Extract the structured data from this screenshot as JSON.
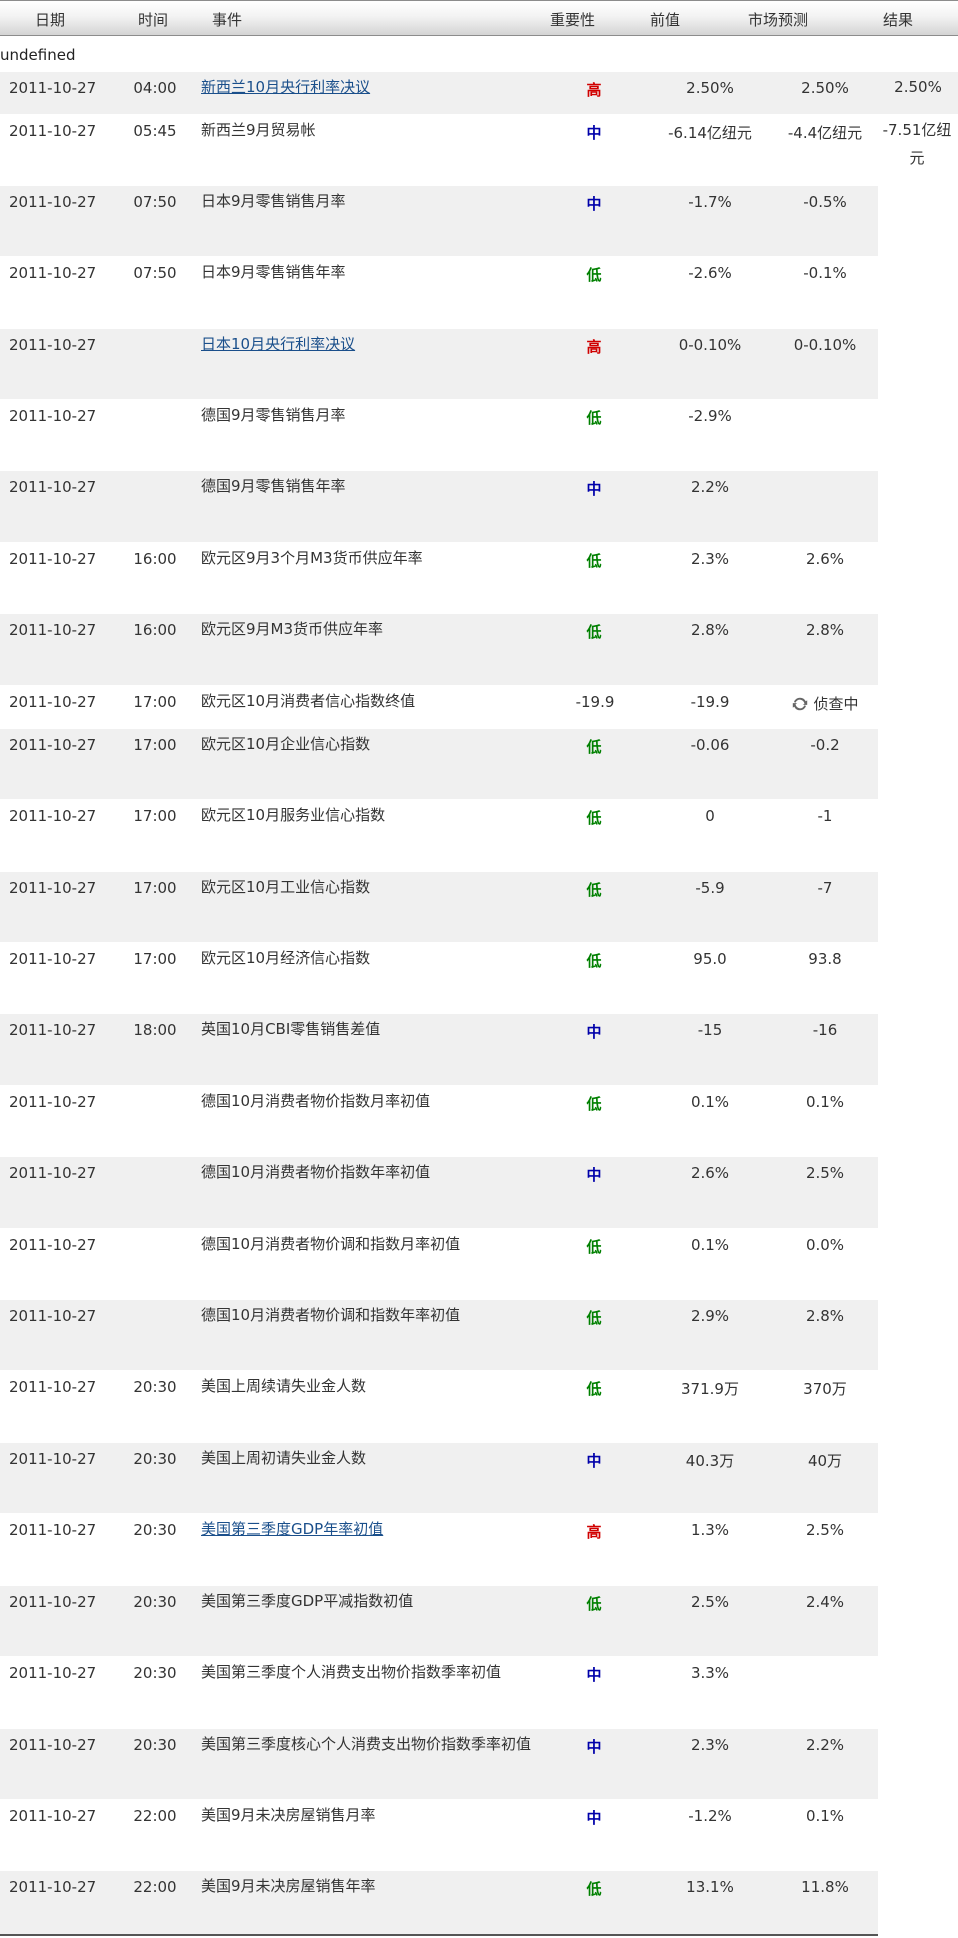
{
  "header": {
    "date": "日期",
    "time": "时间",
    "event": "事件",
    "importance": "重要性",
    "previous": "前值",
    "forecast": "市场预测",
    "result": "结果"
  },
  "undefined_label": "undefined",
  "colors": {
    "high": "#d00000",
    "mid": "#0000aa",
    "low": "#008000",
    "link": "#1a4f8b",
    "row_alt": "#f0f0f0"
  },
  "rows": [
    {
      "date": "2011-10-27",
      "time": "04:00",
      "event": "新西兰10月央行利率决议",
      "link": true,
      "importance": "高",
      "level": "high",
      "previous": "2.50%",
      "forecast": "2.50%",
      "result": "2.50%"
    },
    {
      "date": "2011-10-27",
      "time": "05:45",
      "event": "新西兰9月贸易帐",
      "link": false,
      "importance": "中",
      "level": "mid",
      "previous": "-6.14亿纽元",
      "forecast": "-4.4亿纽元",
      "result": "-7.51亿纽元"
    },
    {
      "date": "2011-10-27",
      "time": "07:50",
      "event": "日本9月零售销售月率",
      "link": false,
      "importance": "中",
      "level": "mid",
      "previous": "-1.7%",
      "forecast": "-0.5%",
      "result": ""
    },
    {
      "date": "2011-10-27",
      "time": "07:50",
      "event": "日本9月零售销售年率",
      "link": false,
      "importance": "低",
      "level": "low",
      "previous": "-2.6%",
      "forecast": "-0.1%",
      "result": ""
    },
    {
      "date": "2011-10-27",
      "time": "",
      "event": "日本10月央行利率决议",
      "link": true,
      "importance": "高",
      "level": "high",
      "previous": "0-0.10%",
      "forecast": "0-0.10%",
      "result": ""
    },
    {
      "date": "2011-10-27",
      "time": "",
      "event": "德国9月零售销售月率",
      "link": false,
      "importance": "低",
      "level": "low",
      "previous": "-2.9%",
      "forecast": "",
      "result": ""
    },
    {
      "date": "2011-10-27",
      "time": "",
      "event": "德国9月零售销售年率",
      "link": false,
      "importance": "中",
      "level": "mid",
      "previous": "2.2%",
      "forecast": "",
      "result": ""
    },
    {
      "date": "2011-10-27",
      "time": "16:00",
      "event": "欧元区9月3个月M3货币供应年率",
      "link": false,
      "importance": "低",
      "level": "low",
      "previous": "2.3%",
      "forecast": "2.6%",
      "result": ""
    },
    {
      "date": "2011-10-27",
      "time": "16:00",
      "event": "欧元区9月M3货币供应年率",
      "link": false,
      "importance": "低",
      "level": "low",
      "previous": "2.8%",
      "forecast": "2.8%",
      "result": ""
    },
    {
      "date": "2011-10-27",
      "time": "17:00",
      "event": "欧元区10月消费者信心指数终值",
      "link": false,
      "importance": "-19.9",
      "level": "num",
      "previous": "-19.9",
      "forecast": "",
      "result": "",
      "pending": "侦查中"
    },
    {
      "date": "2011-10-27",
      "time": "17:00",
      "event": "欧元区10月企业信心指数",
      "link": false,
      "importance": "低",
      "level": "low",
      "previous": "-0.06",
      "forecast": "-0.2",
      "result": ""
    },
    {
      "date": "2011-10-27",
      "time": "17:00",
      "event": "欧元区10月服务业信心指数",
      "link": false,
      "importance": "低",
      "level": "low",
      "previous": "0",
      "forecast": "-1",
      "result": ""
    },
    {
      "date": "2011-10-27",
      "time": "17:00",
      "event": "欧元区10月工业信心指数",
      "link": false,
      "importance": "低",
      "level": "low",
      "previous": "-5.9",
      "forecast": "-7",
      "result": ""
    },
    {
      "date": "2011-10-27",
      "time": "17:00",
      "event": "欧元区10月经济信心指数",
      "link": false,
      "importance": "低",
      "level": "low",
      "previous": "95.0",
      "forecast": "93.8",
      "result": ""
    },
    {
      "date": "2011-10-27",
      "time": "18:00",
      "event": "英国10月CBI零售销售差值",
      "link": false,
      "importance": "中",
      "level": "mid",
      "previous": "-15",
      "forecast": "-16",
      "result": ""
    },
    {
      "date": "2011-10-27",
      "time": "",
      "event": "德国10月消费者物价指数月率初值",
      "link": false,
      "importance": "低",
      "level": "low",
      "previous": "0.1%",
      "forecast": "0.1%",
      "result": ""
    },
    {
      "date": "2011-10-27",
      "time": "",
      "event": "德国10月消费者物价指数年率初值",
      "link": false,
      "importance": "中",
      "level": "mid",
      "previous": "2.6%",
      "forecast": "2.5%",
      "result": ""
    },
    {
      "date": "2011-10-27",
      "time": "",
      "event": "德国10月消费者物价调和指数月率初值",
      "link": false,
      "importance": "低",
      "level": "low",
      "previous": "0.1%",
      "forecast": "0.0%",
      "result": ""
    },
    {
      "date": "2011-10-27",
      "time": "",
      "event": "德国10月消费者物价调和指数年率初值",
      "link": false,
      "importance": "低",
      "level": "low",
      "previous": "2.9%",
      "forecast": "2.8%",
      "result": ""
    },
    {
      "date": "2011-10-27",
      "time": "20:30",
      "event": "美国上周续请失业金人数",
      "link": false,
      "importance": "低",
      "level": "low",
      "previous": "371.9万",
      "forecast": "370万",
      "result": ""
    },
    {
      "date": "2011-10-27",
      "time": "20:30",
      "event": "美国上周初请失业金人数",
      "link": false,
      "importance": "中",
      "level": "mid",
      "previous": "40.3万",
      "forecast": "40万",
      "result": ""
    },
    {
      "date": "2011-10-27",
      "time": "20:30",
      "event": "美国第三季度GDP年率初值",
      "link": true,
      "importance": "高",
      "level": "high",
      "previous": "1.3%",
      "forecast": "2.5%",
      "result": ""
    },
    {
      "date": "2011-10-27",
      "time": "20:30",
      "event": "美国第三季度GDP平减指数初值",
      "link": false,
      "importance": "低",
      "level": "low",
      "previous": "2.5%",
      "forecast": "2.4%",
      "result": ""
    },
    {
      "date": "2011-10-27",
      "time": "20:30",
      "event": "美国第三季度个人消费支出物价指数季率初值",
      "link": false,
      "importance": "中",
      "level": "mid",
      "previous": "3.3%",
      "forecast": "",
      "result": ""
    },
    {
      "date": "2011-10-27",
      "time": "20:30",
      "event": "美国第三季度核心个人消费支出物价指数季率初值",
      "link": false,
      "importance": "中",
      "level": "mid",
      "previous": "2.3%",
      "forecast": "2.2%",
      "result": ""
    },
    {
      "date": "2011-10-27",
      "time": "22:00",
      "event": "美国9月未决房屋销售月率",
      "link": false,
      "importance": "中",
      "level": "mid",
      "previous": "-1.2%",
      "forecast": "0.1%",
      "result": ""
    },
    {
      "date": "2011-10-27",
      "time": "22:00",
      "event": "美国9月未决房屋销售年率",
      "link": false,
      "importance": "低",
      "level": "low",
      "previous": "13.1%",
      "forecast": "11.8%",
      "result": ""
    }
  ]
}
